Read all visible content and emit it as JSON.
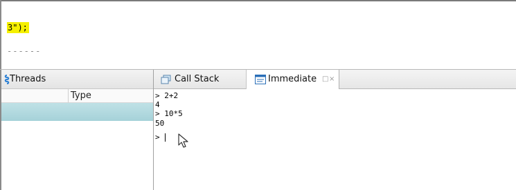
{
  "editor": {
    "code_line": "3\");",
    "dash_line": "------"
  },
  "threads_panel": {
    "tab_label": "Threads",
    "column_type": "Type"
  },
  "right_tabs": {
    "call_stack_label": "Call Stack",
    "immediate_label": "Immediate"
  },
  "immediate": {
    "lines": [
      "> 2+2",
      "4",
      "> 10*5",
      "50",
      "> "
    ]
  },
  "colors": {
    "highlight": "#f5f000",
    "selected_row": "#a6d2d9"
  },
  "icons": {
    "threads": "threads-icon",
    "call_stack": "call-stack-icon",
    "immediate": "immediate-icon",
    "maximize": "maximize-icon",
    "close": "close-icon",
    "cursor": "mouse-pointer-icon"
  }
}
